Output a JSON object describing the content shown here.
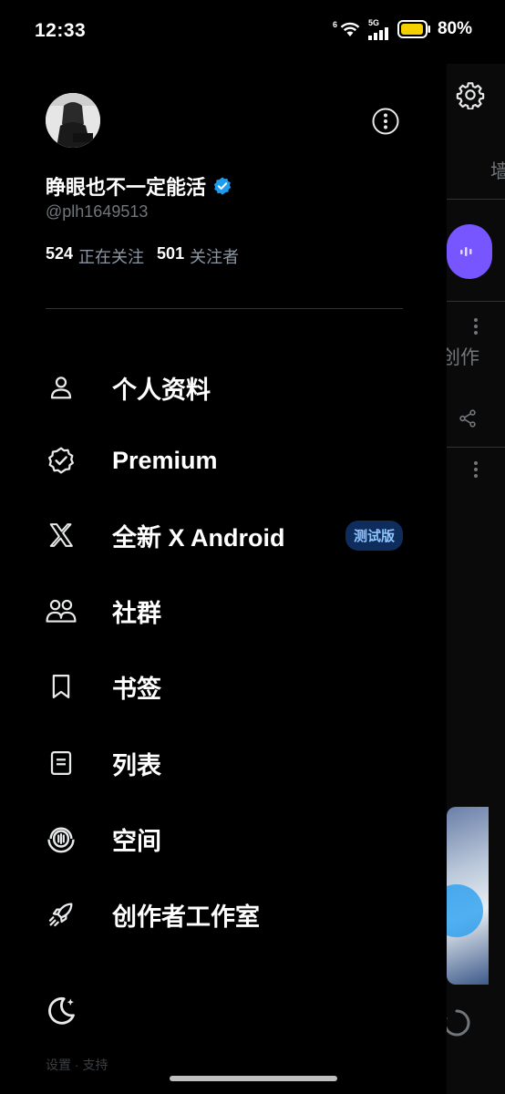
{
  "status_bar": {
    "time": "12:33",
    "wifi_tag": "6",
    "network": "5G",
    "battery": "80%",
    "battery_color": "#f5d000"
  },
  "profile": {
    "display_name": "睁眼也不一定能活",
    "handle": "@plh1649513",
    "following_count": "524",
    "following_label": "正在关注",
    "followers_count": "501",
    "followers_label": "关注者",
    "verified_color": "#1d9bf0"
  },
  "menu": {
    "items": [
      {
        "label": "个人资料",
        "icon": "person-icon"
      },
      {
        "label": "Premium",
        "icon": "verified-badge-icon"
      },
      {
        "label": "全新 X Android",
        "icon": "x-logo-icon",
        "badge": "测试版"
      },
      {
        "label": "社群",
        "icon": "communities-icon"
      },
      {
        "label": "书签",
        "icon": "bookmark-icon"
      },
      {
        "label": "列表",
        "icon": "list-icon"
      },
      {
        "label": "空间",
        "icon": "spaces-icon"
      },
      {
        "label": "创作者工作室",
        "icon": "rocket-icon"
      }
    ]
  },
  "background_page": {
    "tab_partial": "墙",
    "text_partial": "创作"
  },
  "footer": {
    "theme_icon": "moon-icon",
    "cut_text": "设置 · 支持"
  }
}
